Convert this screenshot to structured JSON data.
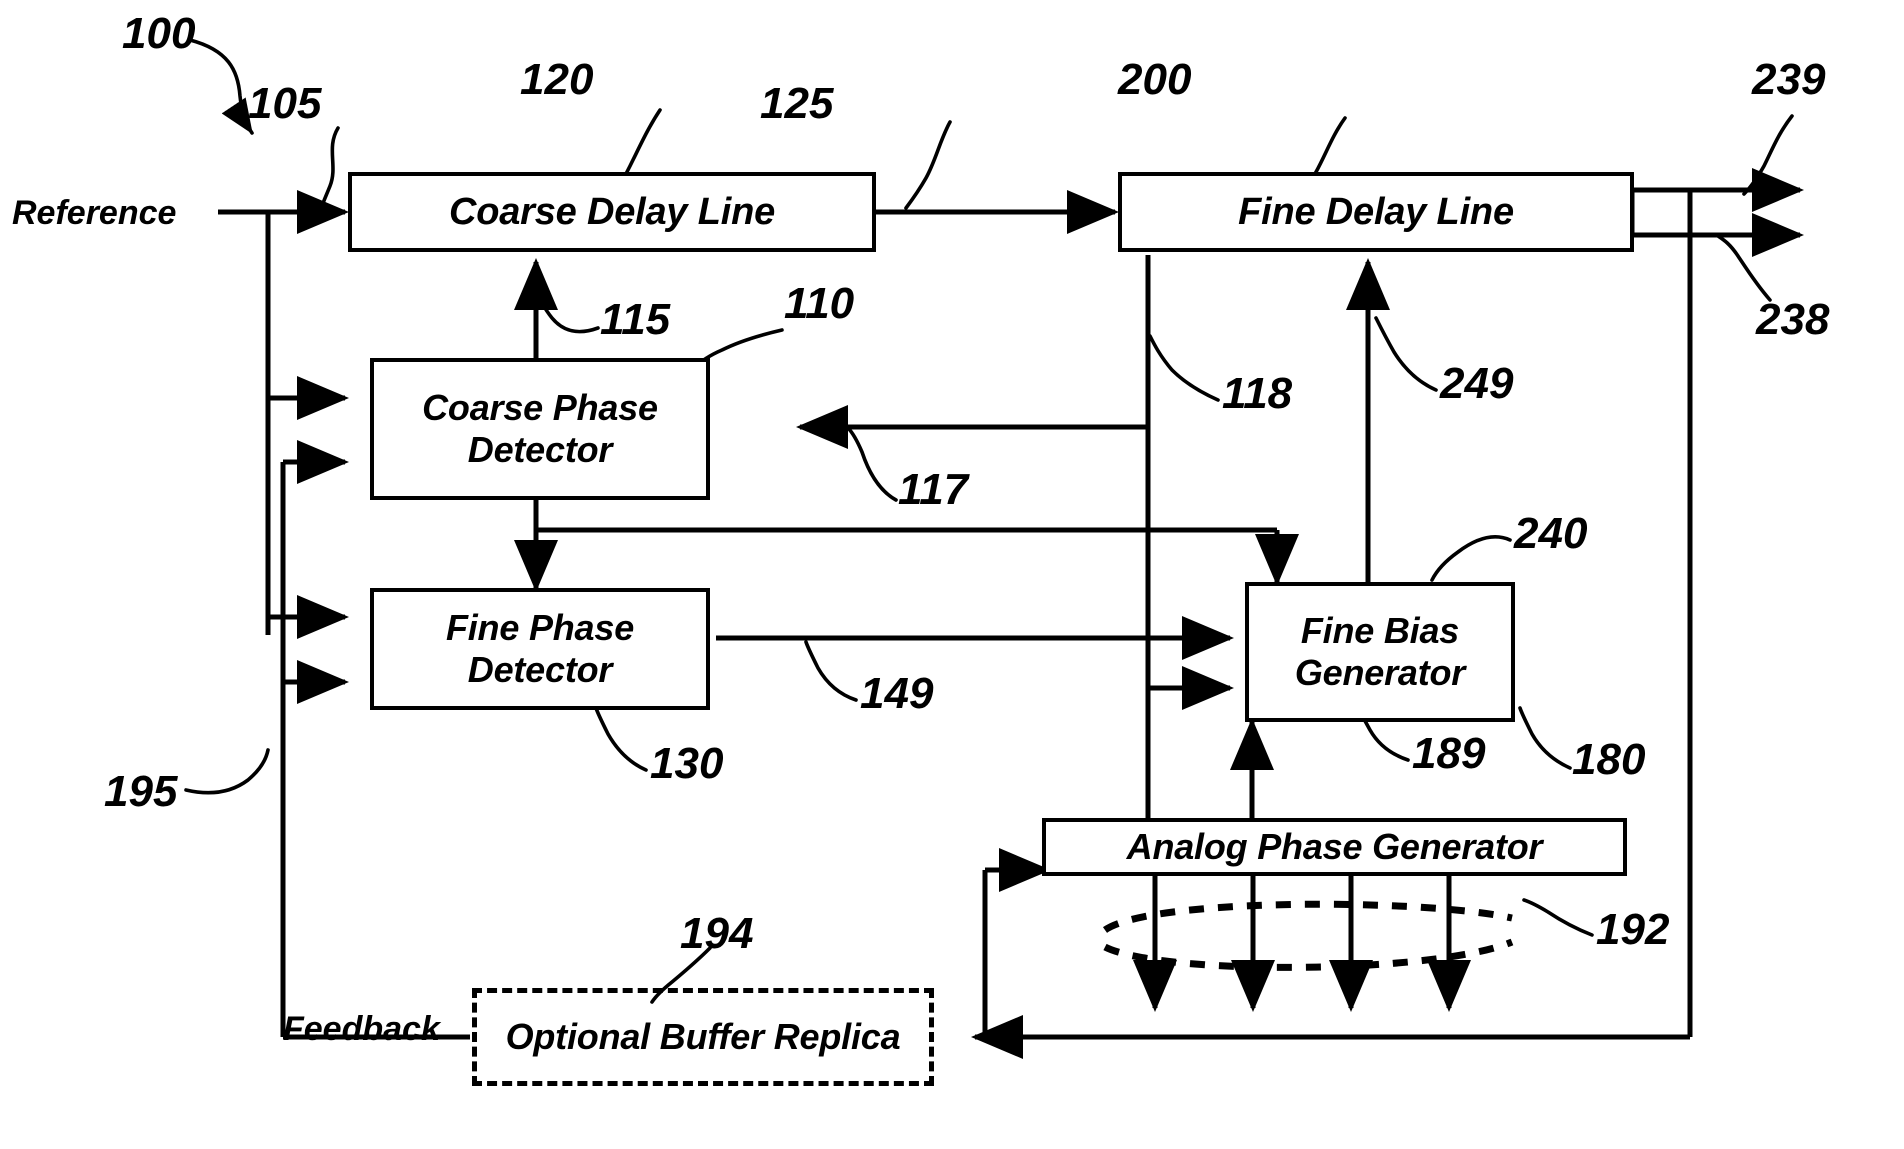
{
  "figure": {
    "kind": "patent-block-diagram",
    "stroke_color": "#000000",
    "background_color": "#ffffff"
  },
  "blocks": [
    {
      "id": "coarse_delay_line",
      "label": "Coarse Delay Line",
      "numeral": "120",
      "style": "solid"
    },
    {
      "id": "fine_delay_line",
      "label": "Fine Delay Line",
      "numeral": "200",
      "style": "solid"
    },
    {
      "id": "coarse_phase_det",
      "label": "Coarse Phase\nDetector",
      "numeral": "110",
      "style": "solid"
    },
    {
      "id": "fine_phase_det",
      "label": "Fine Phase\nDetector",
      "numeral": "130",
      "style": "solid"
    },
    {
      "id": "fine_bias_gen",
      "label": "Fine Bias\nGenerator",
      "numeral": "240",
      "style": "solid"
    },
    {
      "id": "analog_phase_gen",
      "label": "Analog Phase Generator",
      "numeral": "180",
      "style": "solid"
    },
    {
      "id": "optional_buffer",
      "label": "Optional Buffer Replica",
      "numeral": "194",
      "style": "dashed"
    }
  ],
  "signal_labels": {
    "reference": "Reference",
    "feedback": "Feedback"
  },
  "numerals": {
    "system": "100",
    "reference_input": "105",
    "coarse_pd": "110",
    "coarse_ctrl": "115",
    "fine_pd_ctrl_117": "117",
    "fine_delay_ctrl_118": "118",
    "coarse_delay_line": "120",
    "coarse_to_fine": "125",
    "fine_pd": "130",
    "fine_pd_out": "149",
    "analog_phase_gen": "180",
    "apg_to_bias": "189",
    "phase_taps": "192",
    "optional_buffer": "194",
    "feedback_net": "195",
    "fine_delay_line": "200",
    "output_238": "238",
    "output_239": "239",
    "fine_bias_gen": "240",
    "bias_to_fine_delay": "249"
  }
}
